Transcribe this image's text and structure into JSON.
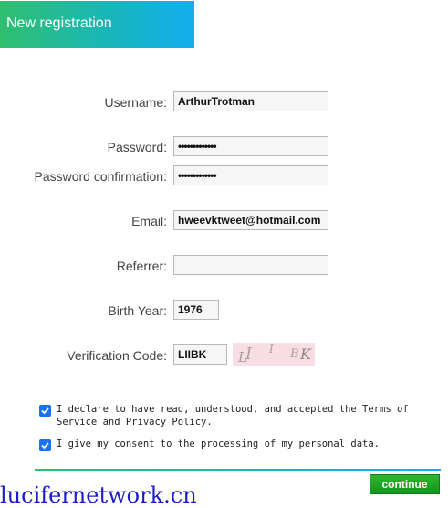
{
  "header": {
    "title": "New registration"
  },
  "form": {
    "username": {
      "label": "Username:",
      "value": "ArthurTrotman"
    },
    "password": {
      "label": "Password:",
      "value": "•••••••••••••"
    },
    "password_confirmation": {
      "label": "Password confirmation:",
      "value": "•••••••••••••"
    },
    "email": {
      "label": "Email:",
      "value": "hweevktweet@hotmail.com"
    },
    "referrer": {
      "label": "Referrer:",
      "value": ""
    },
    "birth_year": {
      "label": "Birth Year:",
      "value": "1976"
    },
    "verification_code": {
      "label": "Verification Code:",
      "value": "LIIBK"
    }
  },
  "captcha": {
    "chars": [
      "L",
      "I",
      "I",
      "B",
      "K"
    ]
  },
  "consents": {
    "terms_text": "I declare to have read, understood, and accepted the Terms of Service and Privacy Policy.",
    "terms_checked": true,
    "data_text": "I give my consent to the processing of my personal data.",
    "data_checked": true
  },
  "continue_label": "continue",
  "watermark": "lucifernetwork.cn",
  "colors": {
    "accent_green": "#2fbf6f",
    "accent_blue": "#14aef0",
    "checkbox": "#1a73e8",
    "button": "#12961c"
  }
}
